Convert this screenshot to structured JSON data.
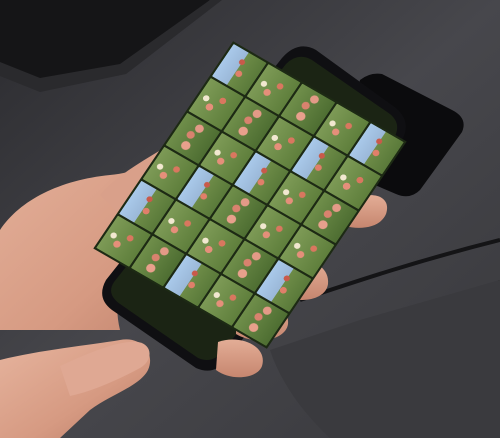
{
  "scene": {
    "description_colors": {
      "background": "#3b3b3f",
      "table_surface": "#47474c",
      "phone_body": "#0f0f12",
      "skin": "#d9a08a",
      "screen_grass": "#6d8b47",
      "screen_sky": "#a9c9ea"
    },
    "objects": [
      "table-surface",
      "background-device",
      "charging-cable",
      "smartphone",
      "phone-screen-photo-grid",
      "left-hand",
      "right-hand"
    ]
  }
}
